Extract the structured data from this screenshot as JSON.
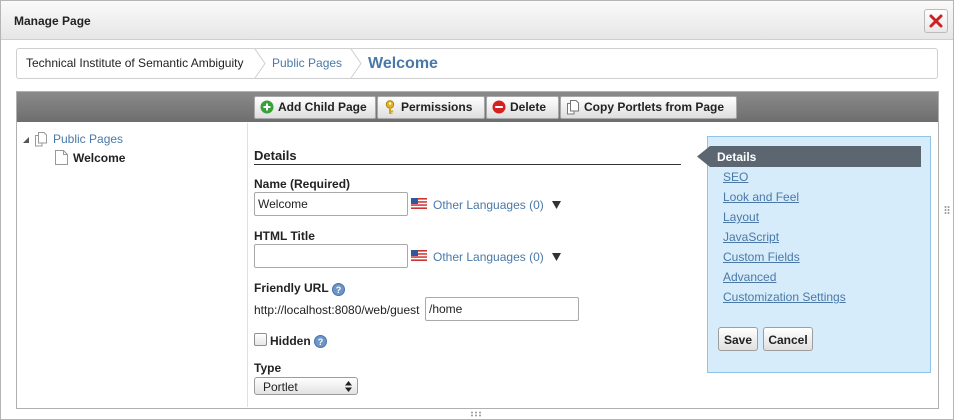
{
  "dialog": {
    "title": "Manage Page"
  },
  "breadcrumb": {
    "items": [
      "Technical Institute of Semantic Ambiguity",
      "Public Pages",
      "Welcome"
    ]
  },
  "toolbar": {
    "add_child_page": "Add Child Page",
    "permissions": "Permissions",
    "delete": "Delete",
    "copy_portlets": "Copy Portlets from Page"
  },
  "tree": {
    "root": "Public Pages",
    "child": "Welcome"
  },
  "form": {
    "section_title": "Details",
    "name_label": "Name (Required)",
    "name_value": "Welcome",
    "other_languages": "Other Languages (0)",
    "html_title_label": "HTML Title",
    "html_title_value": "",
    "friendly_url_label": "Friendly URL",
    "friendly_url_prefix": "http://localhost:8080/web/guest",
    "friendly_url_value": "/home",
    "hidden_label": "Hidden",
    "hidden_checked": false,
    "type_label": "Type",
    "type_value": "Portlet"
  },
  "side_nav": {
    "active": "Details",
    "links": [
      "SEO",
      "Look and Feel",
      "Layout",
      "JavaScript",
      "Custom Fields",
      "Advanced",
      "Customization Settings"
    ],
    "save": "Save",
    "cancel": "Cancel"
  },
  "colors": {
    "link": "#4a79a8",
    "toolbar": "#7a7a7a",
    "side_panel": "#d6ecfa",
    "close_icon": "#cc2222"
  },
  "icons": [
    "close-icon",
    "add-icon",
    "key-icon",
    "delete-icon",
    "copy-icon",
    "page-icon",
    "flag-icon",
    "help-icon",
    "chevron-down-icon"
  ]
}
